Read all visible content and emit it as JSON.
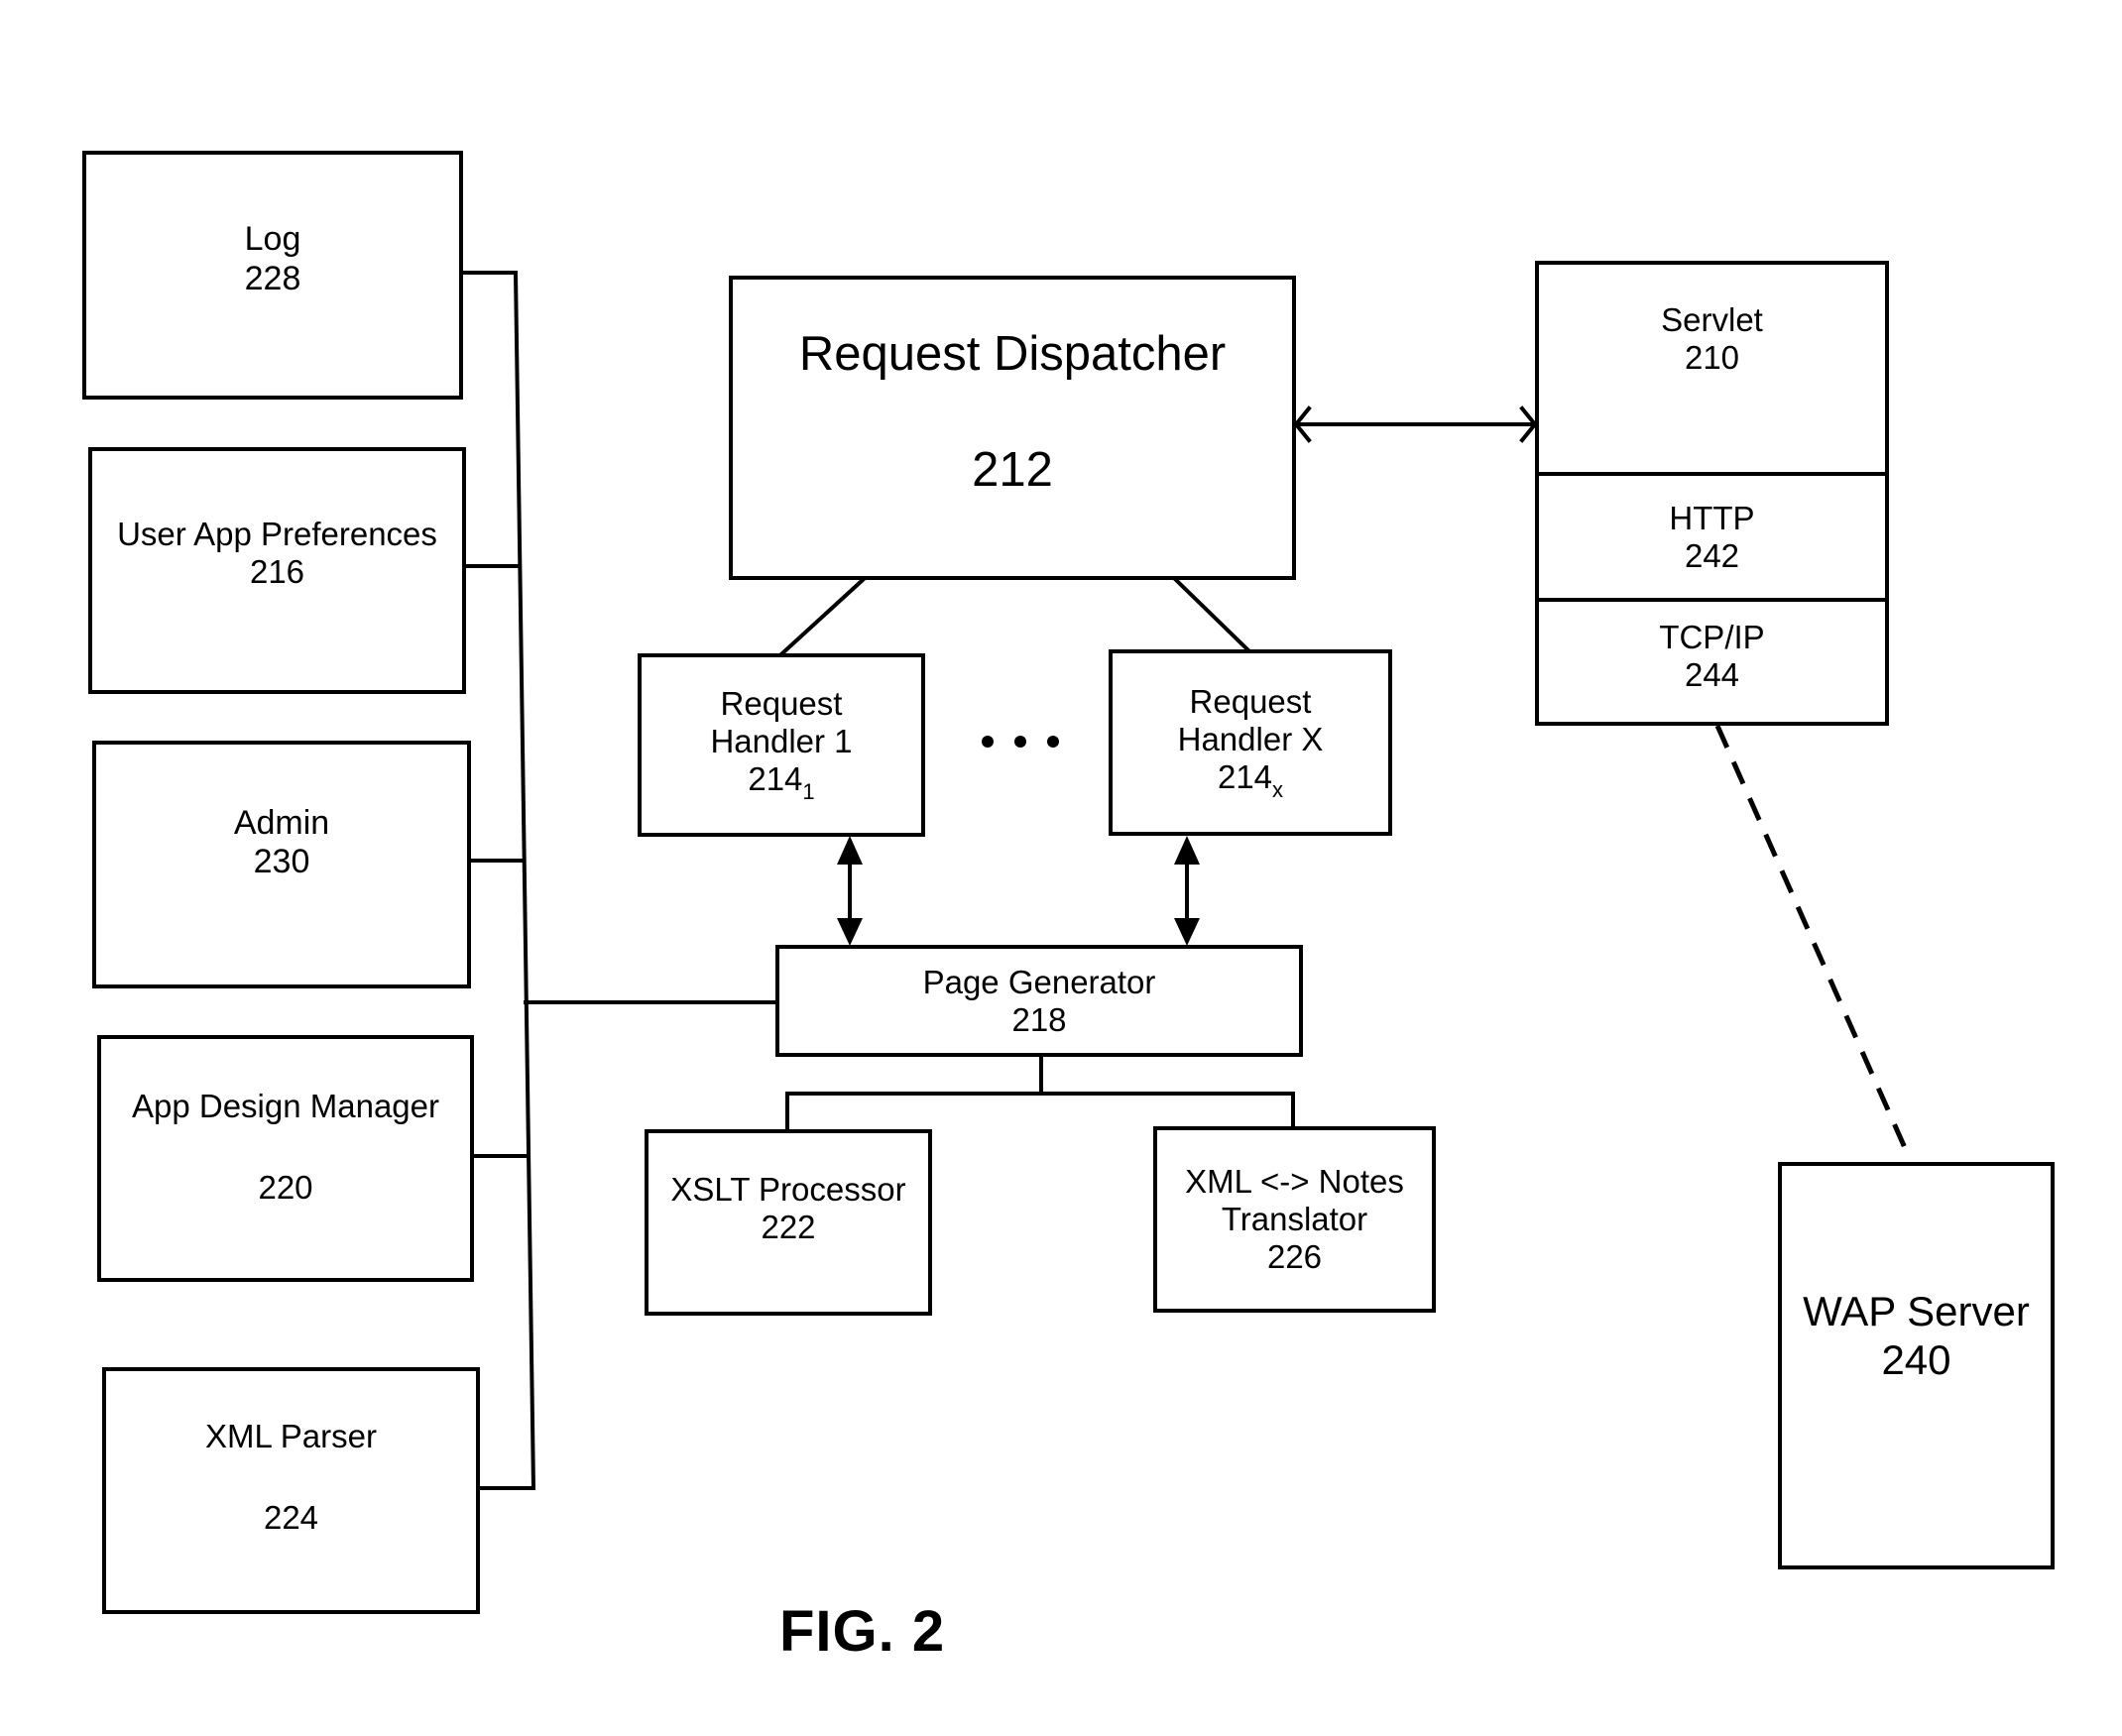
{
  "figure": {
    "caption": "FIG. 2"
  },
  "components": {
    "log": {
      "name": "Log",
      "ref": "228"
    },
    "user_app_preferences": {
      "name": "User App Preferences",
      "ref": "216"
    },
    "admin": {
      "name": "Admin",
      "ref": "230"
    },
    "app_design_manager": {
      "name": "App Design Manager",
      "ref": "220"
    },
    "xml_parser": {
      "name": "XML Parser",
      "ref": "224"
    },
    "request_dispatcher": {
      "name": "Request Dispatcher",
      "ref": "212"
    },
    "request_handler_1": {
      "line1": "Request",
      "line2": "Handler 1",
      "ref": "214",
      "subscript": "1"
    },
    "request_handler_x": {
      "line1": "Request",
      "line2": "Handler X",
      "ref": "214",
      "subscript": "x"
    },
    "ellipsis": "• • •",
    "page_generator": {
      "name": "Page Generator",
      "ref": "218"
    },
    "xslt_processor": {
      "name": "XSLT Processor",
      "ref": "222"
    },
    "xml_notes_translator": {
      "line1": "XML <-> Notes",
      "line2": "Translator",
      "ref": "226"
    },
    "servlet": {
      "name": "Servlet",
      "ref": "210"
    },
    "http": {
      "name": "HTTP",
      "ref": "242"
    },
    "tcpip": {
      "name": "TCP/IP",
      "ref": "244"
    },
    "wap_server": {
      "name": "WAP Server",
      "ref": "240"
    }
  },
  "connections": [
    {
      "from": "request_dispatcher",
      "to": "servlet",
      "style": "bidirectional-open-arrow"
    },
    {
      "from": "request_dispatcher",
      "to": "request_handler_1",
      "style": "line"
    },
    {
      "from": "request_dispatcher",
      "to": "request_handler_x",
      "style": "line"
    },
    {
      "from": "request_handler_1",
      "to": "page_generator",
      "style": "bidirectional-arrow"
    },
    {
      "from": "request_handler_x",
      "to": "page_generator",
      "style": "bidirectional-arrow"
    },
    {
      "from": "page_generator",
      "to": "xslt_processor",
      "style": "line"
    },
    {
      "from": "page_generator",
      "to": "xml_notes_translator",
      "style": "line"
    },
    {
      "from": "page_generator",
      "to": "bus",
      "style": "line"
    },
    {
      "from": "log",
      "to": "bus",
      "style": "line"
    },
    {
      "from": "user_app_preferences",
      "to": "bus",
      "style": "line"
    },
    {
      "from": "admin",
      "to": "bus",
      "style": "line"
    },
    {
      "from": "app_design_manager",
      "to": "bus",
      "style": "line"
    },
    {
      "from": "xml_parser",
      "to": "bus",
      "style": "line"
    },
    {
      "from": "tcpip",
      "to": "wap_server",
      "style": "dashed"
    }
  ]
}
